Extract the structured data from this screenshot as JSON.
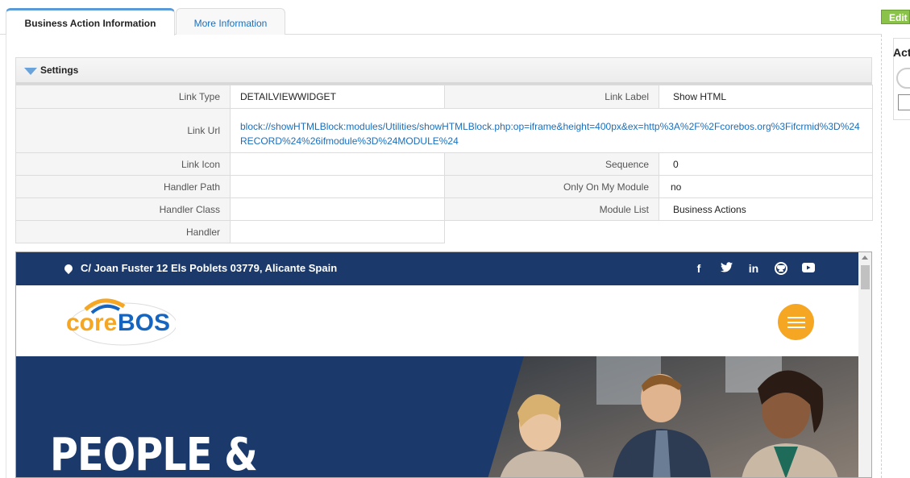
{
  "tabs": [
    {
      "label": "Business Action Information",
      "active": true
    },
    {
      "label": "More Information",
      "active": false
    }
  ],
  "edit_button": "Edit",
  "side_panel_title": "Act",
  "settings": {
    "title": "Settings",
    "fields": {
      "link_type": {
        "label": "Link Type",
        "value": "DETAILVIEWWIDGET"
      },
      "link_label": {
        "label": "Link Label",
        "value": "Show HTML"
      },
      "link_url": {
        "label": "Link Url",
        "value": "block://showHTMLBlock:modules/Utilities/showHTMLBlock.php:op=iframe&height=400px&ex=http%3A%2F%2Fcorebos.org%3Fifcrmid%3D%24RECORD%24%26ifmodule%3D%24MODULE%24"
      },
      "link_icon": {
        "label": "Link Icon",
        "value": ""
      },
      "sequence": {
        "label": "Sequence",
        "value": "0"
      },
      "handler_path": {
        "label": "Handler Path",
        "value": ""
      },
      "only_on_my_module": {
        "label": "Only On My Module",
        "value": "no"
      },
      "handler_class": {
        "label": "Handler Class",
        "value": ""
      },
      "module_list": {
        "label": "Module List",
        "value": "Business Actions"
      },
      "handler": {
        "label": "Handler",
        "value": ""
      }
    }
  },
  "preview": {
    "address": "C/ Joan Fuster 12 Els Poblets 03779, Alicante Spain",
    "social_icons": [
      "facebook-icon",
      "twitter-icon",
      "linkedin-icon",
      "github-icon",
      "youtube-icon"
    ],
    "logo_text_core": "core",
    "logo_text_bos": "BOS",
    "hero_title": "PEOPLE &",
    "colors": {
      "navy": "#1b3a6b",
      "orange": "#f5a623",
      "logo_blue": "#1565c0"
    }
  }
}
